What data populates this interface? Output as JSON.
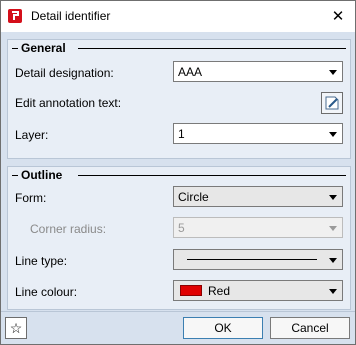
{
  "window": {
    "title": "Detail identifier",
    "close_glyph": "✕",
    "app_icon": "allplan-logo-icon"
  },
  "general": {
    "heading": "General",
    "detail_designation": {
      "label": "Detail designation:",
      "value": "AAA"
    },
    "edit_annotation": {
      "label": "Edit annotation text:",
      "icon": "edit-text-icon"
    },
    "layer": {
      "label": "Layer:",
      "value": "1"
    }
  },
  "outline": {
    "heading": "Outline",
    "form": {
      "label": "Form:",
      "value": "Circle"
    },
    "corner_radius": {
      "label": "Corner radius:",
      "value": "5"
    },
    "line_type": {
      "label": "Line type:"
    },
    "line_colour": {
      "label": "Line colour:",
      "value": "Red",
      "color": "#e00000"
    }
  },
  "footer": {
    "star_glyph": "☆",
    "ok_label": "OK",
    "cancel_label": "Cancel"
  }
}
